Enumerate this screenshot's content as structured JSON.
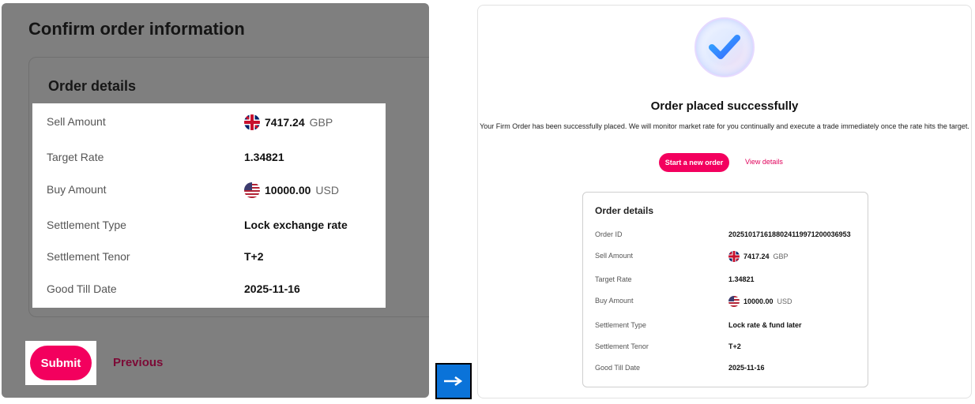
{
  "confirm": {
    "title": "Confirm order information",
    "card_title": "Order details",
    "rows": [
      {
        "label": "Sell Amount",
        "value": "7417.24",
        "currency": "GBP",
        "flag": "uk-flag-icon"
      },
      {
        "label": "Target Rate",
        "value": "1.34821"
      },
      {
        "label": "Buy Amount",
        "value": "10000.00",
        "currency": "USD",
        "flag": "us-flag-icon"
      },
      {
        "label": "Settlement Type",
        "value": "Lock exchange rate"
      },
      {
        "label": "Settlement Tenor",
        "value": "T+2"
      },
      {
        "label": "Good Till Date",
        "value": "2025-11-16"
      }
    ],
    "submit_label": "Submit",
    "previous_label": "Previous"
  },
  "arrow_icon": "right-arrow-icon",
  "success": {
    "icon": "checkmark-badge-icon",
    "title": "Order placed successfully",
    "message": "Your Firm Order has been successfully placed. We will monitor market rate for you continually and execute a trade immediately once the rate hits the target.",
    "start_new_order_label": "Start a new order",
    "view_details_label": "View details",
    "details": {
      "title": "Order details",
      "rows": [
        {
          "label": "Order ID",
          "value": "20251017161880241199712000369​53"
        },
        {
          "label": "Sell Amount",
          "value": "7417.24",
          "currency": "GBP",
          "flag": "uk-flag-icon"
        },
        {
          "label": "Target Rate",
          "value": "1.34821"
        },
        {
          "label": "Buy Amount",
          "value": "10000.00",
          "currency": "USD",
          "flag": "us-flag-icon"
        },
        {
          "label": "Settlement Type",
          "value": "Lock rate & fund later"
        },
        {
          "label": "Settlement Tenor",
          "value": "T+2"
        },
        {
          "label": "Good Till Date",
          "value": "2025-11-16"
        }
      ]
    }
  },
  "colors": {
    "accent": "#f3005e",
    "overlay_gray": "#7f7f7f",
    "arrow_blue": "#0a73d9"
  }
}
